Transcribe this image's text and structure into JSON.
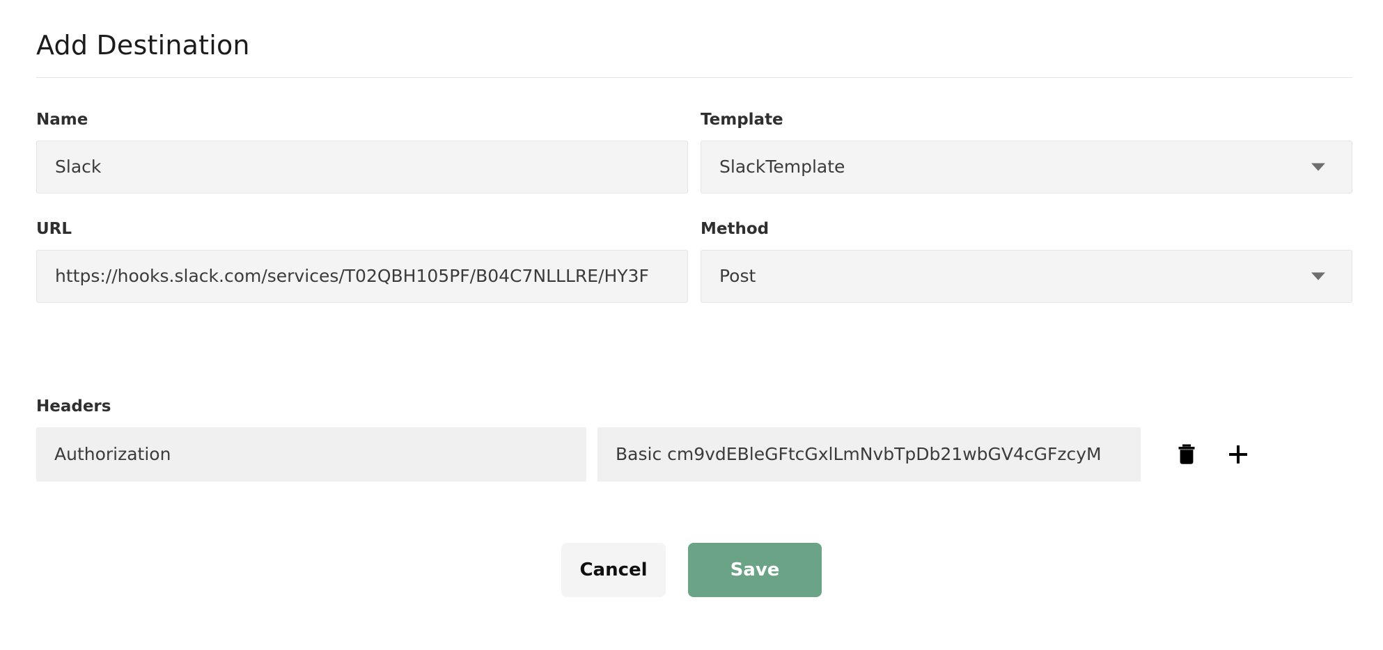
{
  "dialog": {
    "title": "Add Destination"
  },
  "fields": {
    "name": {
      "label": "Name",
      "value": "Slack",
      "placeholder": "Name"
    },
    "template": {
      "label": "Template",
      "value": "SlackTemplate",
      "options": [
        "SlackTemplate"
      ]
    },
    "url": {
      "label": "URL",
      "value": "https://hooks.slack.com/services/T02QBH105PF/B04C7NLLLRE/HY3F",
      "placeholder": "URL"
    },
    "method": {
      "label": "Method",
      "value": "Post",
      "options": [
        "Post"
      ]
    }
  },
  "headers": {
    "label": "Headers",
    "rows": [
      {
        "key": "Authorization",
        "value": "Basic cm9vdEBleGFtcGxlLmNvbTpDb21wbGV4cGFzcyM",
        "key_placeholder": "Key",
        "value_placeholder": "Value"
      }
    ],
    "delete_icon": "trash-icon",
    "add_icon": "plus-icon"
  },
  "actions": {
    "cancel_label": "Cancel",
    "save_label": "Save"
  },
  "colors": {
    "accent_green": "#6ba386",
    "field_background": "#f4f4f4",
    "header_field_background": "#f0f0f0",
    "text_primary": "#2f2f2f",
    "divider": "#e2e2e2"
  }
}
